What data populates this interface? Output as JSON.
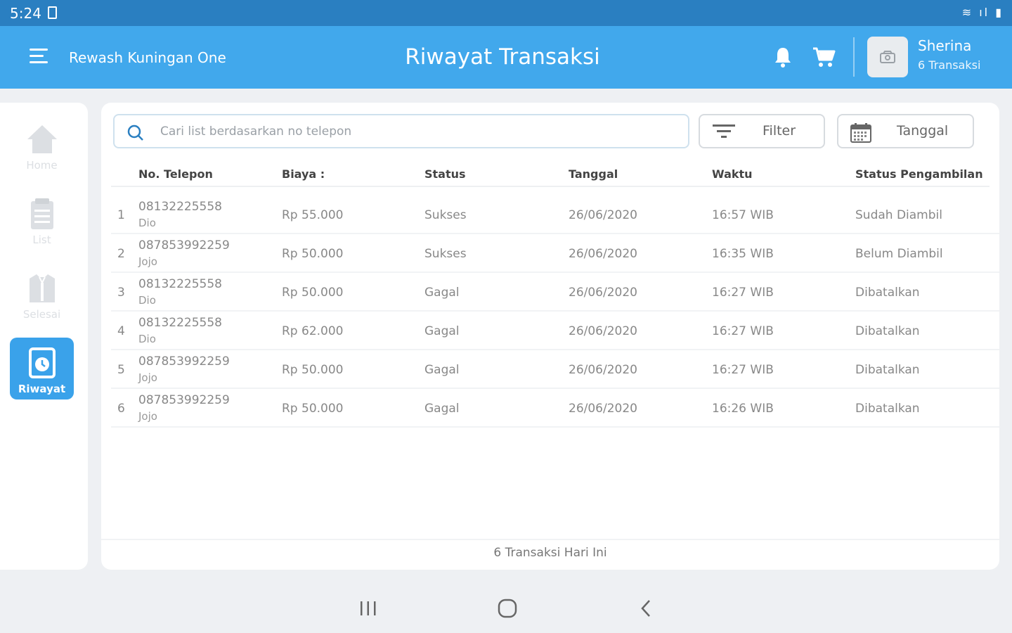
{
  "status_bar": {
    "time": "5:24",
    "icons": "≋ ıl ▮"
  },
  "app_bar": {
    "store_name": "Rewash Kuningan One",
    "title": "Riwayat Transaksi",
    "user_name": "Sherina",
    "user_transactions": "6 Transaksi"
  },
  "sidebar": {
    "items": [
      {
        "label": "Home",
        "icon": "home-icon"
      },
      {
        "label": "List",
        "icon": "list-icon"
      },
      {
        "label": "Selesai",
        "icon": "shirt-icon"
      },
      {
        "label": "Riwayat",
        "icon": "history-icon",
        "active": true
      }
    ]
  },
  "search": {
    "placeholder": "Cari list berdasarkan no telepon",
    "value": ""
  },
  "toolbar": {
    "filter_label": "Filter",
    "date_label": "Tanggal"
  },
  "table": {
    "headers": [
      "No. Telepon",
      "Biaya :",
      "Status",
      "Tanggal",
      "Waktu",
      "Status Pengambilan"
    ],
    "rows": [
      {
        "no": "1",
        "phone": "08132225558",
        "name": "Dio",
        "fee": "Rp 55.000",
        "status": "Sukses",
        "date": "26/06/2020",
        "time": "16:57 WIB",
        "pickup": "Sudah Diambil"
      },
      {
        "no": "2",
        "phone": "087853992259",
        "name": "Jojo",
        "fee": "Rp 50.000",
        "status": "Sukses",
        "date": "26/06/2020",
        "time": "16:35 WIB",
        "pickup": "Belum Diambil"
      },
      {
        "no": "3",
        "phone": "08132225558",
        "name": "Dio",
        "fee": "Rp 50.000",
        "status": "Gagal",
        "date": "26/06/2020",
        "time": "16:27 WIB",
        "pickup": "Dibatalkan"
      },
      {
        "no": "4",
        "phone": "08132225558",
        "name": "Dio",
        "fee": "Rp 62.000",
        "status": "Gagal",
        "date": "26/06/2020",
        "time": "16:27 WIB",
        "pickup": "Dibatalkan"
      },
      {
        "no": "5",
        "phone": "087853992259",
        "name": "Jojo",
        "fee": "Rp 50.000",
        "status": "Gagal",
        "date": "26/06/2020",
        "time": "16:27 WIB",
        "pickup": "Dibatalkan"
      },
      {
        "no": "6",
        "phone": "087853992259",
        "name": "Jojo",
        "fee": "Rp 50.000",
        "status": "Gagal",
        "date": "26/06/2020",
        "time": "16:26 WIB",
        "pickup": "Dibatalkan"
      }
    ]
  },
  "footer": {
    "summary": "6 Transaksi Hari Ini"
  },
  "colors": {
    "primary": "#41a8ec",
    "status_bar": "#2a7fc1",
    "active_nav": "#3aa2ea",
    "background": "#eef0f3"
  }
}
